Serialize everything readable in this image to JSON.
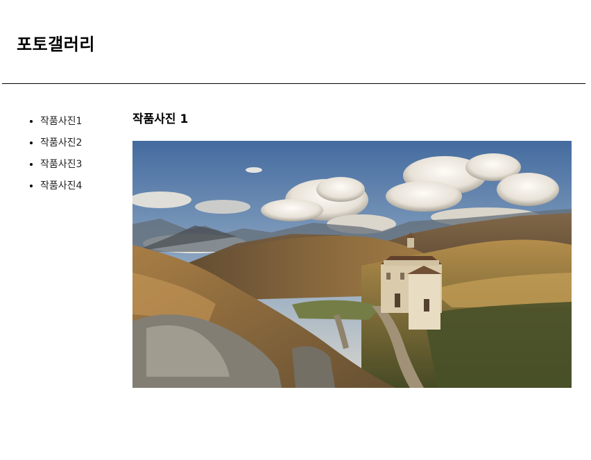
{
  "header": {
    "title": "포토갤러리"
  },
  "sidebar": {
    "items": [
      {
        "label": "작품사진1"
      },
      {
        "label": "작품사진2"
      },
      {
        "label": "작품사진3"
      },
      {
        "label": "작품사진4"
      }
    ]
  },
  "main": {
    "photo_title": "작품사진 1"
  },
  "colors": {
    "text": "#000000",
    "rule": "#000000",
    "sky_top": "#3f6fa8",
    "sky_bottom": "#c7d3dd",
    "hills": "#6b4f2f"
  }
}
